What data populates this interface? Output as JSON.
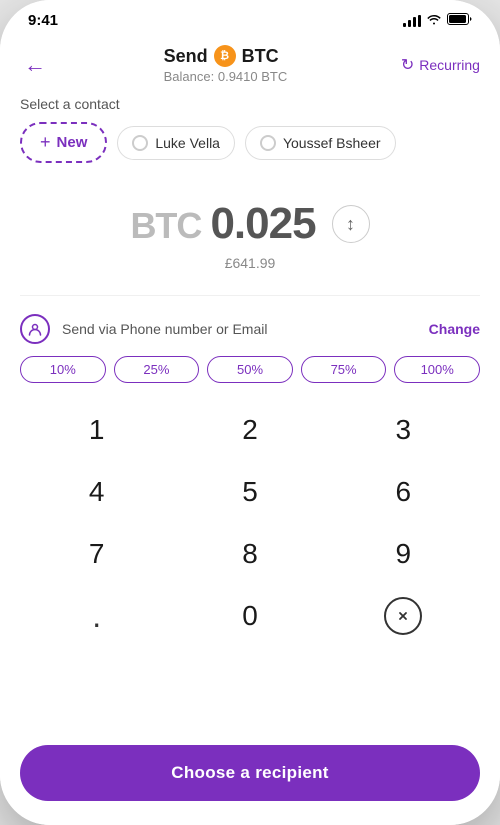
{
  "statusBar": {
    "time": "9:41"
  },
  "header": {
    "title": "Send",
    "currency": "BTC",
    "balance_label": "Balance:",
    "balance_value": "0.9410 BTC",
    "recurring_label": "Recurring"
  },
  "contacts": {
    "section_label": "Select a contact",
    "new_label": "New",
    "items": [
      {
        "name": "Luke Vella"
      },
      {
        "name": "Youssef Bsheer"
      }
    ]
  },
  "amount": {
    "currency_label": "BTC",
    "value": "0.025",
    "fiat": "£641.99"
  },
  "sendMethod": {
    "text": "Send via Phone number or Email",
    "change_label": "Change"
  },
  "percentages": [
    "10%",
    "25%",
    "50%",
    "75%",
    "100%"
  ],
  "numpad": {
    "keys": [
      "1",
      "2",
      "3",
      "4",
      "5",
      "6",
      "7",
      "8",
      "9",
      ".",
      "0",
      "⌫"
    ]
  },
  "footer": {
    "cta_label": "Choose a recipient"
  },
  "colors": {
    "primary": "#7B2FBE",
    "btc_orange": "#F7931A"
  }
}
